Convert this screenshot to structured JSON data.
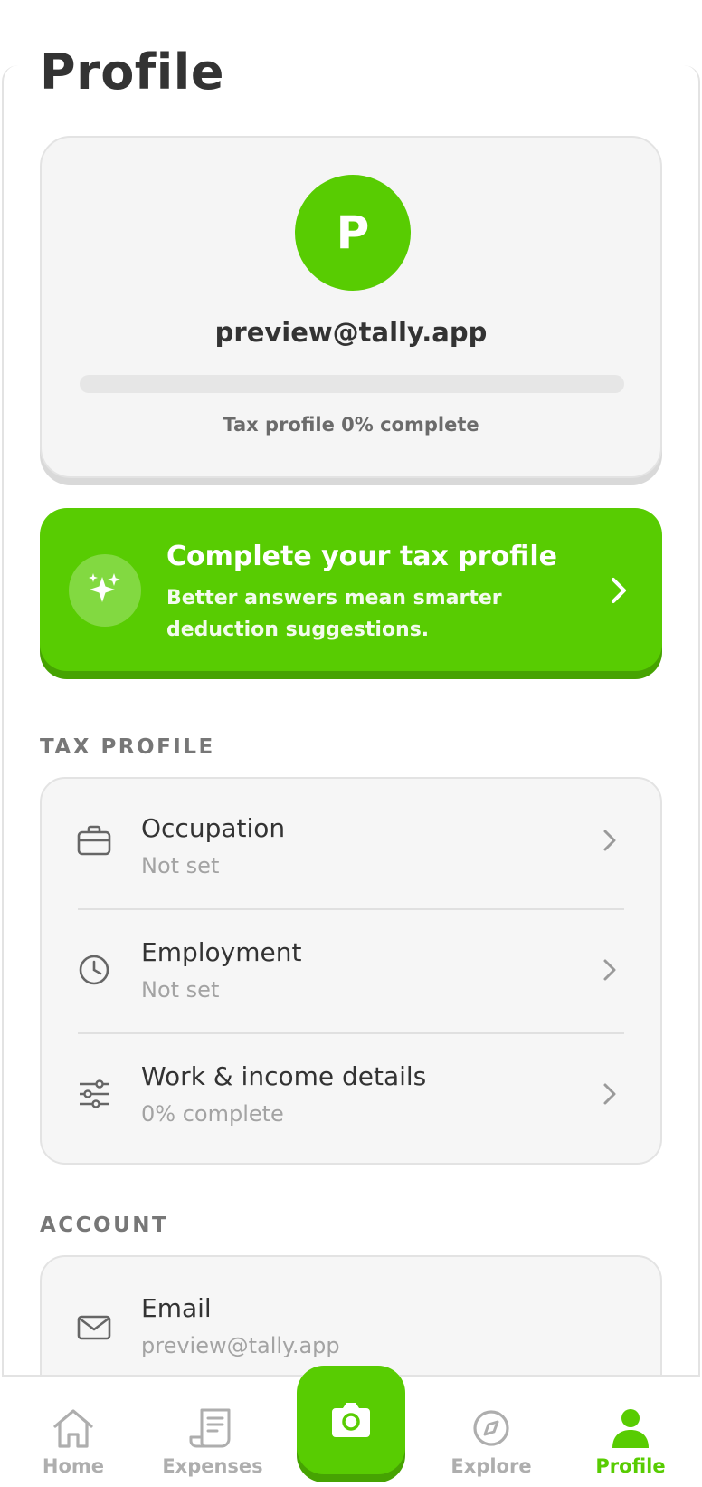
{
  "page": {
    "title": "Profile"
  },
  "profile": {
    "avatar_initial": "P",
    "email": "preview@tally.app",
    "progress_fraction": 0.0,
    "progress_text": "Tax profile 0% complete"
  },
  "banner": {
    "title": "Complete your tax profile",
    "subtitle": "Better answers mean smarter deduction suggestions.",
    "icon": "sparkles-icon"
  },
  "tax_profile": {
    "section_label": "TAX PROFILE",
    "items": [
      {
        "title": "Occupation",
        "subtitle": "Not set",
        "icon": "briefcase-icon"
      },
      {
        "title": "Employment",
        "subtitle": "Not set",
        "icon": "clock-icon"
      },
      {
        "title": "Work & income details",
        "subtitle": "0% complete",
        "icon": "sliders-icon"
      }
    ]
  },
  "account": {
    "section_label": "ACCOUNT",
    "items": [
      {
        "title": "Email",
        "subtitle": "preview@tally.app",
        "icon": "mail-icon"
      }
    ]
  },
  "nav": {
    "items": [
      {
        "label": "Home",
        "icon": "home-icon",
        "active": false
      },
      {
        "label": "Expenses",
        "icon": "receipt-icon",
        "active": false
      },
      {
        "label": "Explore",
        "icon": "compass-icon",
        "active": false
      },
      {
        "label": "Profile",
        "icon": "person-icon",
        "active": true
      }
    ],
    "camera_icon": "camera-icon"
  },
  "colors": {
    "accent": "#58cc02",
    "accent_dark": "#46a302",
    "card_bg": "#f5f5f5",
    "muted_text": "#a3a3a3"
  }
}
